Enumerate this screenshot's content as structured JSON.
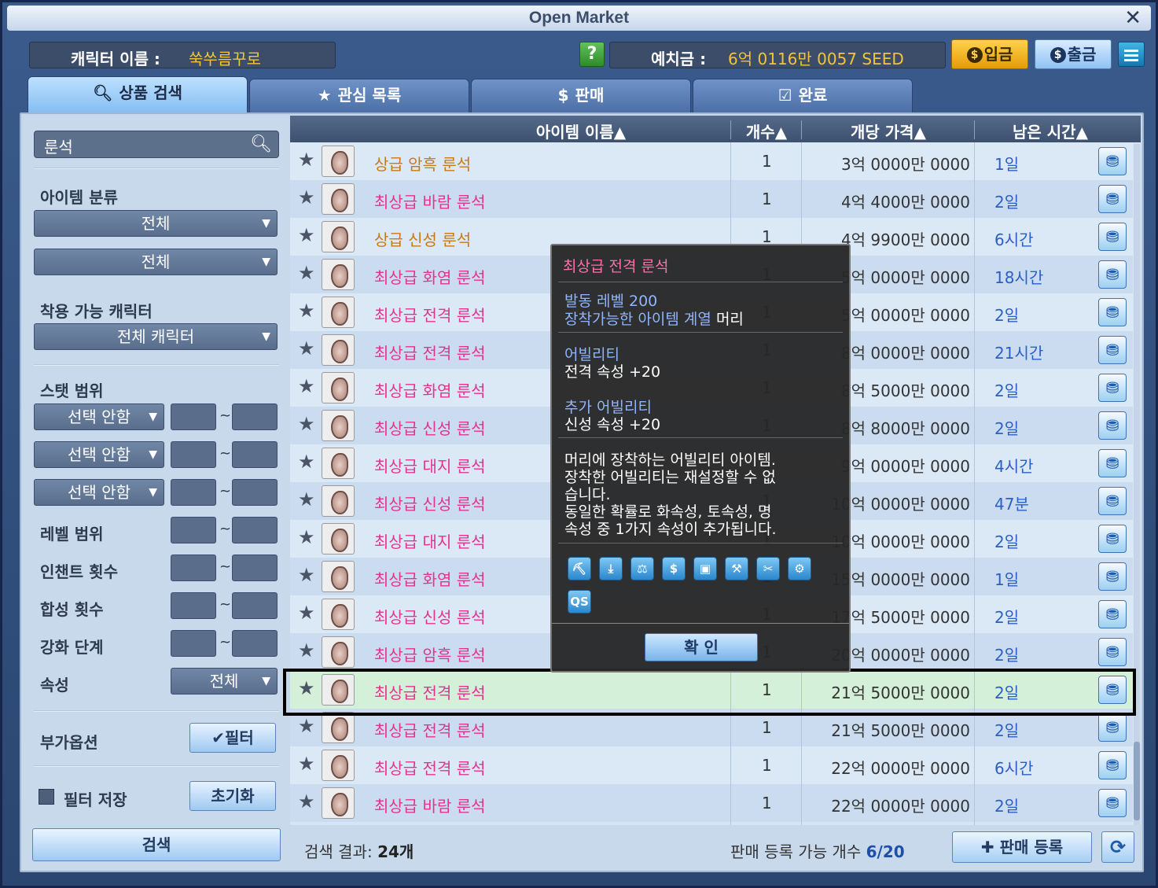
{
  "window": {
    "title": "Open Market",
    "close": "✕"
  },
  "header": {
    "character_label": "캐릭터 이름 :",
    "character_name": "쑥쑤름꾸로",
    "help": "?",
    "balance_label": "예치금 :",
    "balance_value": "6억 0116만 0057 SEED",
    "deposit": "입금",
    "withdraw": "출금"
  },
  "tabs": [
    {
      "label": "상품 검색",
      "icon": "search-icon"
    },
    {
      "label": "관심 목록",
      "icon": "star-icon"
    },
    {
      "label": "판매",
      "icon": "coin-icon"
    },
    {
      "label": "완료",
      "icon": "check-icon"
    }
  ],
  "filters": {
    "search_value": "룬석",
    "category_label": "아이템 분류",
    "category1": "전체",
    "category2": "전체",
    "wearable_label": "착용 가능 캐릭터",
    "wearable_value": "전체 캐릭터",
    "stat_label": "스탯 범위",
    "stat_select": "선택 안함",
    "level_label": "레벨 범위",
    "enchant_label": "인챈트 횟수",
    "synth_label": "합성 횟수",
    "reinforce_label": "강화 단계",
    "attr_label": "속성",
    "attr_value": "전체",
    "extra_label": "부가옵션",
    "filter_btn": "✔필터",
    "save_filter": "필터 저장",
    "reset_btn": "초기화",
    "search_btn": "검색"
  },
  "table": {
    "headers": [
      "아이템 이름▲",
      "개수▲",
      "개당 가격▲",
      "남은 시간▲"
    ],
    "rows": [
      {
        "name": "상급 암흑 룬석",
        "grade": "upper",
        "qty": "1",
        "price": "3억 0000만 0000",
        "time": "1일"
      },
      {
        "name": "최상급 바람 룬석",
        "grade": "top",
        "qty": "1",
        "price": "4억 4000만 0000",
        "time": "2일"
      },
      {
        "name": "상급 신성 룬석",
        "grade": "upper",
        "qty": "1",
        "price": "4억 9900만 0000",
        "time": "6시간"
      },
      {
        "name": "최상급 화염 룬석",
        "grade": "top",
        "qty": "1",
        "price": "5억 0000만 0000",
        "time": "18시간"
      },
      {
        "name": "최상급 전격 룬석",
        "grade": "top",
        "qty": "1",
        "price": "5억 0000만 0000",
        "time": "2일"
      },
      {
        "name": "최상급 전격 룬석",
        "grade": "top",
        "qty": "1",
        "price": "8억 0000만 0000",
        "time": "21시간"
      },
      {
        "name": "최상급 화염 룬석",
        "grade": "top",
        "qty": "1",
        "price": "8억 5000만 0000",
        "time": "2일"
      },
      {
        "name": "최상급 신성 룬석",
        "grade": "top",
        "qty": "1",
        "price": "8억 8000만 0000",
        "time": "2일"
      },
      {
        "name": "최상급 대지 룬석",
        "grade": "top",
        "qty": "1",
        "price": "9억 0000만 0000",
        "time": "4시간"
      },
      {
        "name": "최상급 신성 룬석",
        "grade": "top",
        "qty": "1",
        "price": "10억 0000만 0000",
        "time": "47분"
      },
      {
        "name": "최상급 대지 룬석",
        "grade": "top",
        "qty": "1",
        "price": "10억 0000만 0000",
        "time": "2일"
      },
      {
        "name": "최상급 화염 룬석",
        "grade": "top",
        "qty": "1",
        "price": "15억 0000만 0000",
        "time": "1일"
      },
      {
        "name": "최상급 신성 룬석",
        "grade": "top",
        "qty": "1",
        "price": "17억 5000만 0000",
        "time": "2일"
      },
      {
        "name": "최상급 암흑 룬석",
        "grade": "top",
        "qty": "1",
        "price": "20억 0000만 0000",
        "time": "2일"
      },
      {
        "name": "최상급 전격 룬석",
        "grade": "top",
        "qty": "1",
        "price": "21억 5000만 0000",
        "time": "2일",
        "selected": true
      },
      {
        "name": "최상급 전격 룬석",
        "grade": "top",
        "qty": "1",
        "price": "21억 5000만 0000",
        "time": "2일"
      },
      {
        "name": "최상급 전격 룬석",
        "grade": "top",
        "qty": "1",
        "price": "22억 0000만 0000",
        "time": "6시간"
      },
      {
        "name": "최상급 바람 룬석",
        "grade": "top",
        "qty": "1",
        "price": "22억 0000만 0000",
        "time": "2일"
      }
    ]
  },
  "footer": {
    "result_label": "검색 결과:",
    "result_count": "24개",
    "capacity_label": "판매 등록 가능 개수",
    "capacity_value": "6/20",
    "register_btn": "판매 등록"
  },
  "tooltip": {
    "title": "최상급 전격 룬석",
    "level_line": "발동 레벨 200",
    "equip_line_blue": "장착가능한 아이템 계열",
    "equip_line_white": "머리",
    "ability_label": "어빌리티",
    "ability_value": "전격 속성 +20",
    "extra_label": "추가 어빌리티",
    "extra_value": "신성 속성 +20",
    "desc": [
      "머리에 장착하는 어빌리티 아이템.",
      "장착한 어빌리티는 재설정할 수 없",
      "습니다.",
      "동일한 확률로 화속성, 토속성, 명",
      "속성 중 1가지 속성이 추가됩니다."
    ],
    "icons": [
      "⛏",
      "⤓",
      "⚖",
      "$",
      "▣",
      "⚒",
      "✂",
      "⚙",
      "QS"
    ],
    "ok": "확 인"
  },
  "colors": {
    "upper": "#c77a12",
    "top": "#e0348f",
    "time": "#2a5fc7"
  }
}
